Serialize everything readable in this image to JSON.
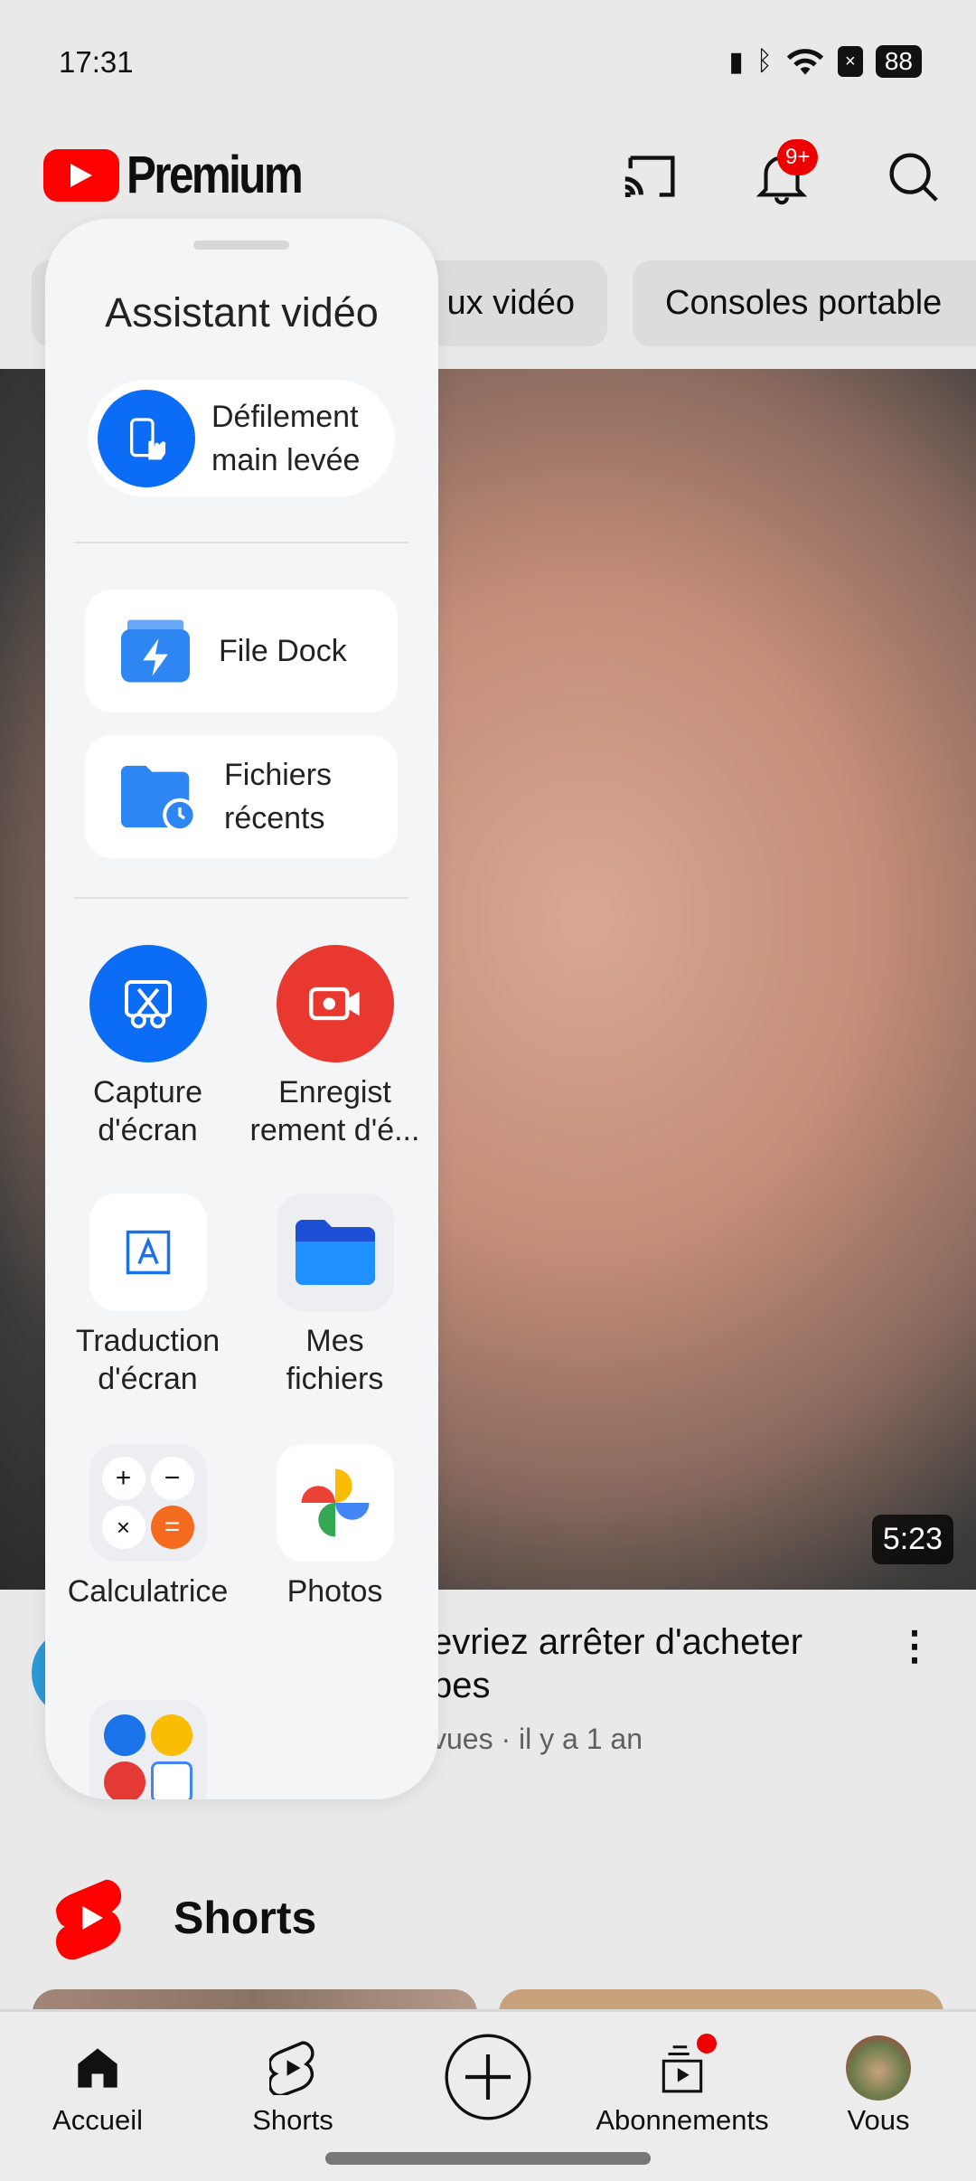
{
  "status_bar": {
    "time": "17:31",
    "battery": "88",
    "icons": [
      "vibrate-icon",
      "bluetooth-icon",
      "wifi-icon",
      "no-sim-icon",
      "battery-icon"
    ]
  },
  "header": {
    "logo_text": "Premium",
    "notification_badge": "9+",
    "icons": [
      "cast-icon",
      "bell-icon",
      "search-icon"
    ]
  },
  "chips": [
    "ux vidéo",
    "Consoles portable"
  ],
  "video": {
    "duration": "5:23",
    "title": "evriez arrêter d'acheter bes",
    "meta": "vues · il y a 1 an"
  },
  "shorts": {
    "title": "Shorts"
  },
  "bottom_nav": [
    {
      "label": "Accueil",
      "icon": "home-icon"
    },
    {
      "label": "Shorts",
      "icon": "shorts-icon"
    },
    {
      "label": "",
      "icon": "create-icon"
    },
    {
      "label": "Abonnements",
      "icon": "subscriptions-icon"
    },
    {
      "label": "Vous",
      "icon": "avatar"
    }
  ],
  "panel": {
    "title": "Assistant vidéo",
    "pill": {
      "label_line1": "Défilement",
      "label_line2": "main levée"
    },
    "cards": [
      {
        "line1": "File Dock",
        "line2": ""
      },
      {
        "line1": "Fichiers",
        "line2": "récents"
      }
    ],
    "apps": [
      {
        "line1": "Capture",
        "line2": "d'écran",
        "color": "#0b6cf5"
      },
      {
        "line1": "Enregist",
        "line2": "rement d'é...",
        "color": "#e9382f"
      },
      {
        "line1": "Traduction",
        "line2": "d'écran"
      },
      {
        "line1": "Mes",
        "line2": "fichiers"
      },
      {
        "line1": "Calculatrice",
        "line2": ""
      },
      {
        "line1": "Photos",
        "line2": ""
      }
    ]
  },
  "colors": {
    "accent_red": "#ff0000",
    "blue": "#0b6cf5"
  }
}
